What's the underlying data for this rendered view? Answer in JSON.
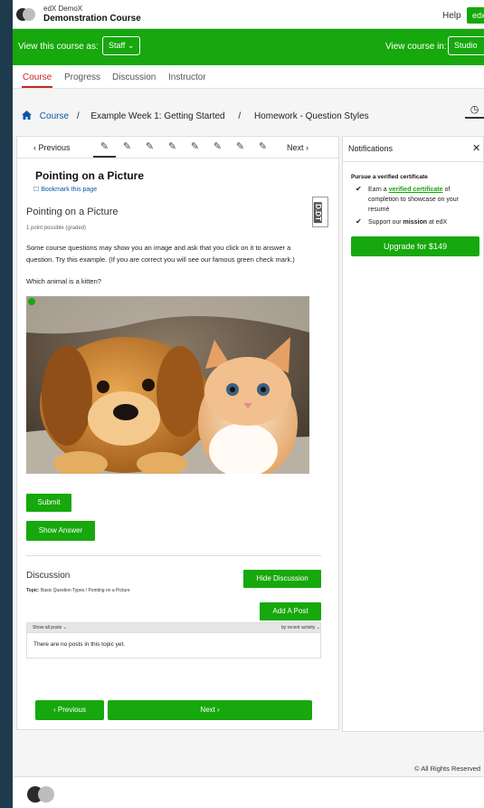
{
  "header": {
    "org": "edX DemoX",
    "course_title": "Demonstration Course",
    "help": "Help",
    "user_menu": "edx ⌄"
  },
  "staffbar": {
    "view_as_label": "View this course as:",
    "view_as_value": "Staff ⌄",
    "view_in_label": "View course in:",
    "view_in_value": "Studio"
  },
  "tabs": [
    "Course",
    "Progress",
    "Discussion",
    "Instructor"
  ],
  "breadcrumb": {
    "home_icon": "home-icon",
    "items": [
      "Course",
      "/",
      "Example Week 1: Getting Started",
      "/",
      "Homework - Question Styles"
    ]
  },
  "sequence": {
    "previous": "‹  Previous",
    "next": "Next  ›",
    "item_icon": "📝"
  },
  "unit": {
    "title": "Pointing on a Picture",
    "bookmark": "☐ Bookmark this page",
    "dt_label": "D.DT"
  },
  "problem": {
    "title": "Pointing on a Picture",
    "points": "1 point possible (graded)",
    "text": "Some course questions may show you an image and ask that you click on it to answer a question. Try this example. (If you are correct you will see our famous green check mark.)",
    "question": "Which animal is a kitten?",
    "submit": "Submit",
    "show_answer": "Show Answer"
  },
  "discussion": {
    "title": "Discussion",
    "hide": "Hide Discussion",
    "topic_label": "Topic:",
    "topic": "Basic Question Types / Pointing on a Picture",
    "add_post": "Add A Post",
    "show_all": "Show all posts ⌄",
    "sort": "by recent activity ⌄",
    "empty": "There are no posts in this topic yet."
  },
  "bottom_nav": {
    "previous": "‹  Previous",
    "next": "Next  ›"
  },
  "sidebar": {
    "title": "Notifications",
    "close": "✕",
    "pursue": "Pursue a verified certificate",
    "item1_pre": "Earn a",
    "item1_link": "verified certificate",
    "item1_post": "of completion to showcase on your resumé",
    "item2_pre": "Support our",
    "item2_bold": "mission",
    "item2_post": "at edX",
    "upgrade": "Upgrade for $149"
  },
  "footer": {
    "copyright": "© All Rights Reserved"
  },
  "colors": {
    "brand_green": "#16a80c",
    "active_tab": "#c62828",
    "link_blue": "#0b56a5"
  }
}
